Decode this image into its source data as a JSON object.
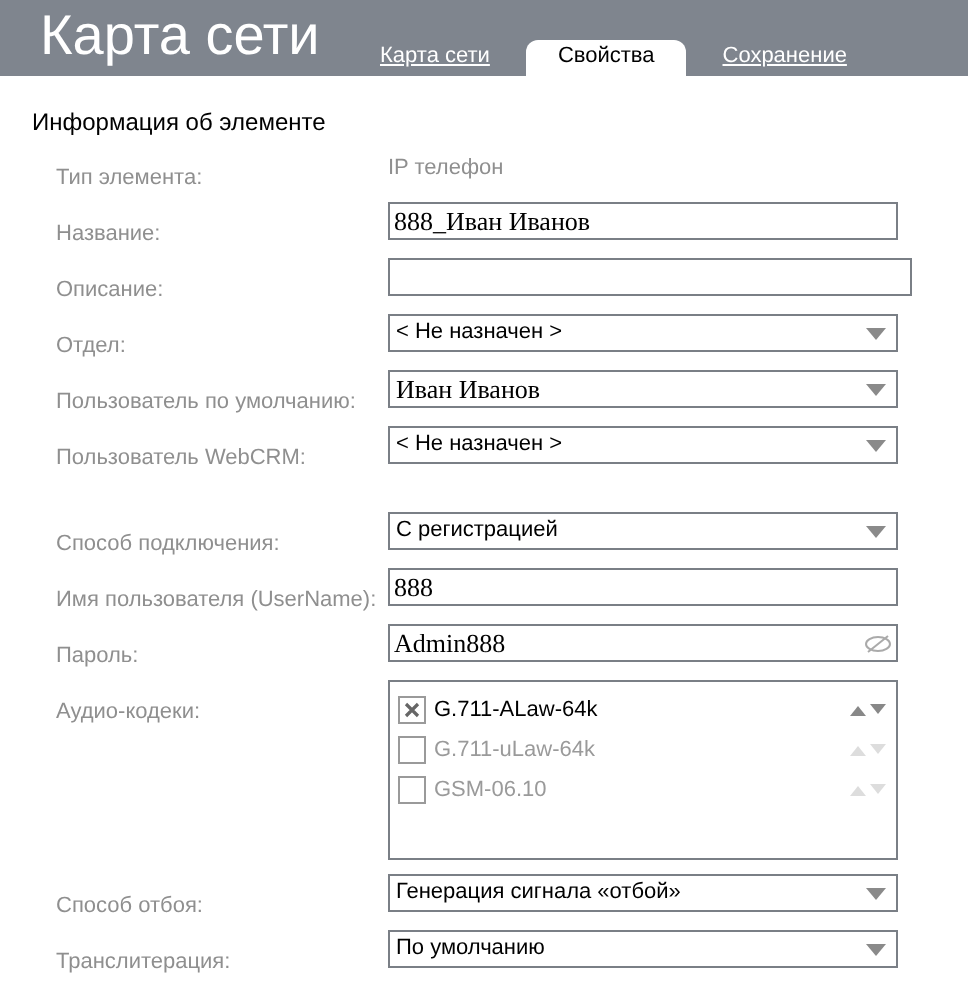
{
  "header": {
    "title": "Карта сети",
    "tabs": [
      {
        "label": "Карта сети",
        "selected": false
      },
      {
        "label": "Свойства",
        "selected": true
      },
      {
        "label": "Сохранение",
        "selected": false
      }
    ]
  },
  "section_title": "Информация об элементе",
  "groups": [
    [
      {
        "kind": "static",
        "label": "Тип элемента:",
        "value": "IP телефон"
      },
      {
        "kind": "text",
        "label": "Название:",
        "value": "888_Иван Иванов",
        "serif": true
      },
      {
        "kind": "text",
        "label": "Описание:",
        "wide": true
      },
      {
        "kind": "select",
        "label": "Отдел:",
        "value": "< Не назначен >"
      },
      {
        "kind": "select",
        "label": "Пользователь по умолчанию:",
        "value": "Иван Иванов",
        "serif": true
      },
      {
        "kind": "select",
        "label": "Пользователь WebCRM:",
        "value": "< Не назначен >"
      }
    ],
    [
      {
        "kind": "select",
        "label": "Способ подключения:",
        "value": "С регистрацией"
      },
      {
        "kind": "text",
        "label": "Имя пользователя (UserName):",
        "value": "888",
        "serif": true
      },
      {
        "kind": "password",
        "label": "Пароль:",
        "value": "Admin888",
        "serif": true
      },
      {
        "kind": "codecs",
        "label": "Аудио-кодеки:",
        "items": [
          {
            "name": "G.711-ALaw-64k",
            "checked": true
          },
          {
            "name": "G.711-uLaw-64k",
            "checked": false
          },
          {
            "name": "GSM-06.10",
            "checked": false
          }
        ]
      },
      {
        "kind": "select",
        "label": "Способ отбоя:",
        "value": "Генерация сигнала «отбой»"
      },
      {
        "kind": "select",
        "label": "Транслитерация:",
        "value": "По умолчанию"
      }
    ]
  ]
}
